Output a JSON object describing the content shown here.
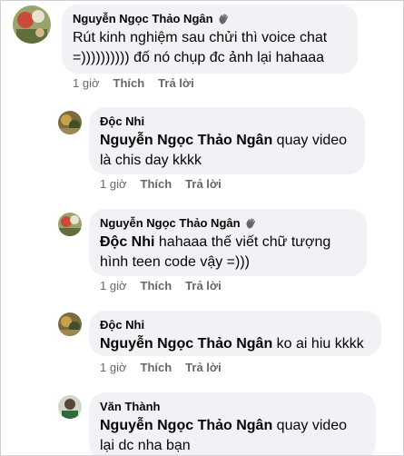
{
  "comments": [
    {
      "name": "Nguyễn Ngọc Thảo Ngân",
      "has_wave": true,
      "mention": "",
      "text": "Rút kinh nghiệm sau chửi thì voice chat =)))))))))) đố nó chụp đc ảnh lại hahaaa",
      "time": "1 giờ",
      "like": "Thích",
      "reply": "Trả lời"
    },
    {
      "name": "Độc Nhi",
      "has_wave": false,
      "mention": "Nguyễn Ngọc Thảo Ngân",
      "text": " quay video là chis day kkkk",
      "time": "1 giờ",
      "like": "Thích",
      "reply": "Trả lời"
    },
    {
      "name": "Nguyễn Ngọc Thảo Ngân",
      "has_wave": true,
      "mention": "Độc Nhi",
      "text": " hahaaa thế viết chữ tượng hình teen code vậy =)))",
      "time": "1 giờ",
      "like": "Thích",
      "reply": "Trả lời"
    },
    {
      "name": "Độc Nhi",
      "has_wave": false,
      "mention": "Nguyễn Ngọc Thảo Ngân",
      "text": " ko ai hiu kkkk",
      "time": "1 giờ",
      "like": "Thích",
      "reply": "Trả lời"
    },
    {
      "name": "Văn Thành",
      "has_wave": false,
      "mention": "Nguyễn Ngọc Thảo Ngân",
      "text": " quay video lại dc nha bạn",
      "time": "",
      "like": "",
      "reply": ""
    }
  ],
  "colors": {
    "bubble": "#f0f2f5",
    "meta": "#65676b",
    "text": "#050505"
  }
}
